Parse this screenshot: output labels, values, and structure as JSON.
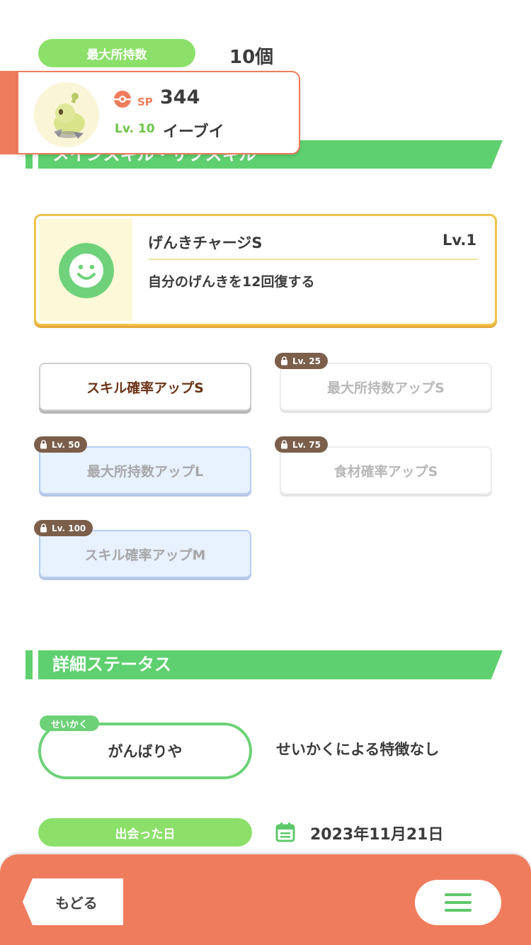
{
  "header": {
    "max_carry_label": "最大所持数",
    "max_carry_value": "10個"
  },
  "pokemon": {
    "sp_label": "SP",
    "sp_value": "344",
    "level_label": "Lv. 10",
    "name": "イーブイ"
  },
  "section_skills": {
    "title": "メインスキル・サブスキル"
  },
  "main_skill": {
    "name": "げんきチャージS",
    "level": "Lv.1",
    "description": "自分のげんきを12回復する"
  },
  "sub_skills": [
    {
      "label": "スキル確率アップS",
      "locked": false,
      "unlock": ""
    },
    {
      "label": "最大所持数アップS",
      "locked": true,
      "unlock": "Lv. 25"
    },
    {
      "label": "最大所持数アップL",
      "locked": true,
      "unlock": "Lv. 50"
    },
    {
      "label": "食材確率アップS",
      "locked": true,
      "unlock": "Lv. 75"
    },
    {
      "label": "スキル確率アップM",
      "locked": true,
      "unlock": "Lv. 100"
    }
  ],
  "section_status": {
    "title": "詳細ステータス"
  },
  "nature": {
    "tag": "せいかく",
    "value": "がんばりや",
    "description": "せいかくによる特徴なし"
  },
  "met": {
    "label": "出会った日",
    "date": "2023年11月21日"
  },
  "footer": {
    "back_label": "もどる"
  },
  "colors": {
    "accent_green": "#5fd06f",
    "accent_orange": "#ef7c5c",
    "lock_brown": "#7b5f4b"
  }
}
